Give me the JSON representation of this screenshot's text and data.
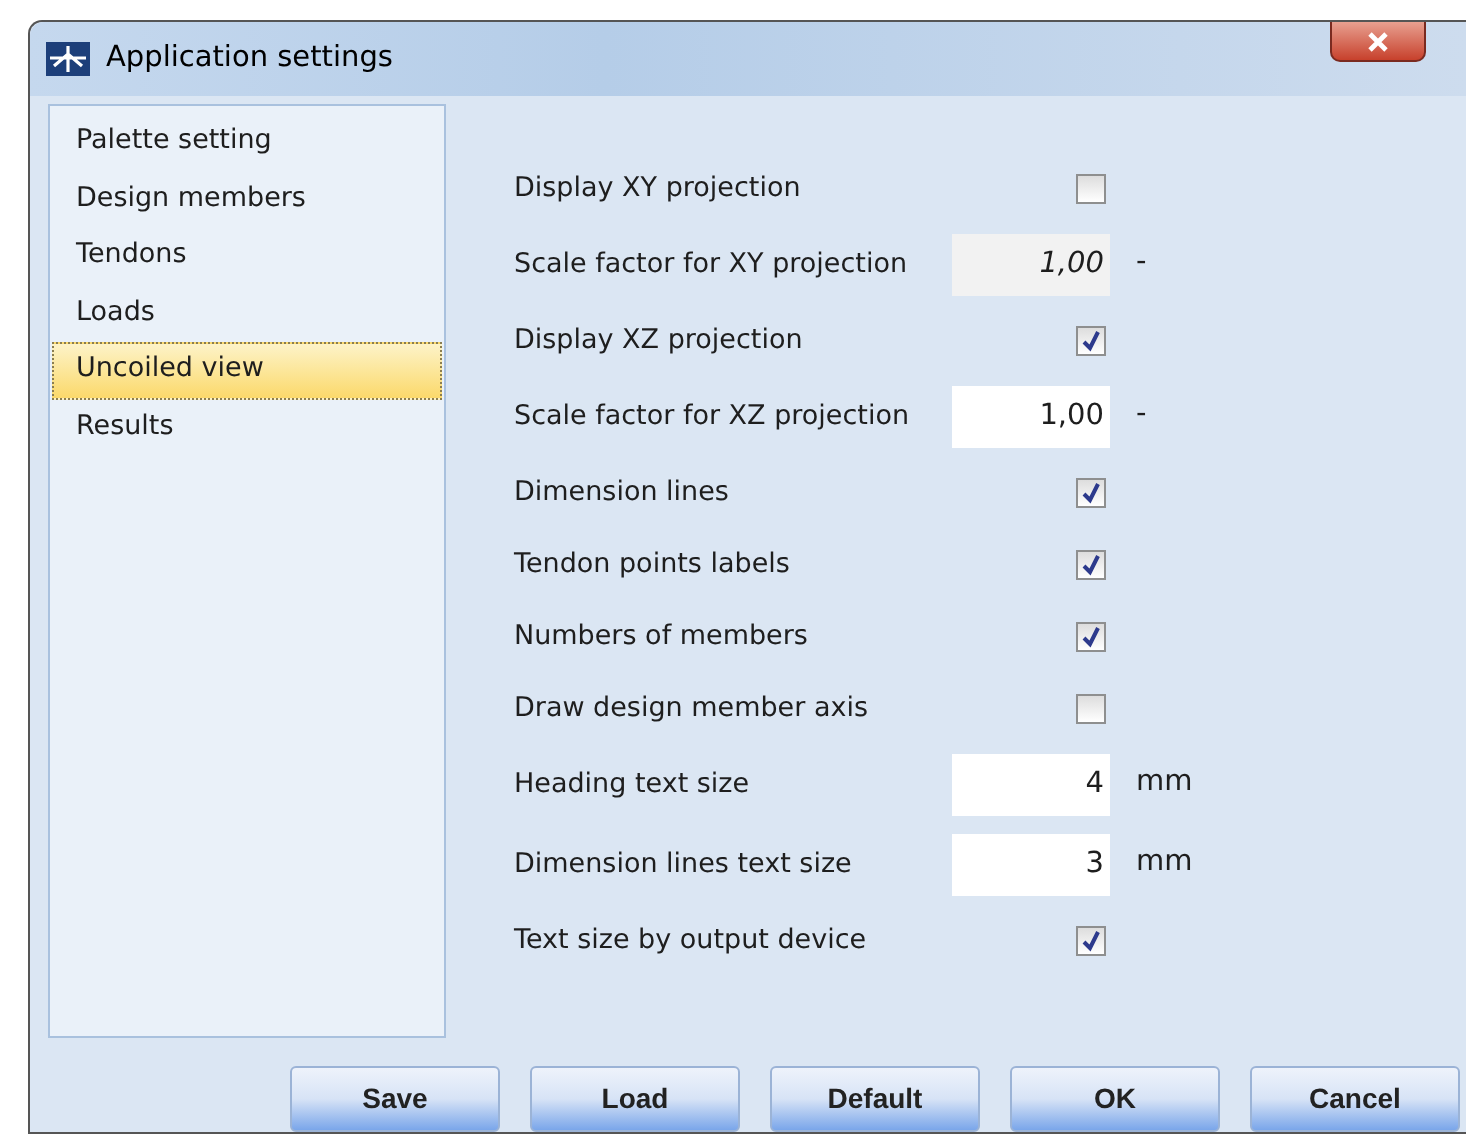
{
  "window": {
    "title": "Application settings"
  },
  "sidebar": {
    "items": [
      {
        "label": "Palette setting",
        "selected": false
      },
      {
        "label": "Design members",
        "selected": false
      },
      {
        "label": "Tendons",
        "selected": false
      },
      {
        "label": "Loads",
        "selected": false
      },
      {
        "label": "Uncoiled view",
        "selected": true
      },
      {
        "label": "Results",
        "selected": false
      }
    ]
  },
  "settings": [
    {
      "kind": "checkbox",
      "label": "Display XY projection",
      "checked": false
    },
    {
      "kind": "number",
      "label": "Scale factor for XY projection",
      "value": "1,00",
      "unit": "-",
      "disabled": true
    },
    {
      "kind": "checkbox",
      "label": "Display XZ projection",
      "checked": true
    },
    {
      "kind": "number",
      "label": "Scale factor for XZ projection",
      "value": "1,00",
      "unit": "-",
      "disabled": false
    },
    {
      "kind": "checkbox",
      "label": "Dimension lines",
      "checked": true
    },
    {
      "kind": "checkbox",
      "label": "Tendon points labels",
      "checked": true
    },
    {
      "kind": "checkbox",
      "label": "Numbers of members",
      "checked": true
    },
    {
      "kind": "checkbox",
      "label": "Draw design member axis",
      "checked": false
    },
    {
      "kind": "number",
      "label": "Heading text size",
      "value": "4",
      "unit": "mm",
      "disabled": false
    },
    {
      "kind": "number",
      "label": "Dimension lines text size",
      "value": "3",
      "unit": "mm",
      "disabled": false
    },
    {
      "kind": "checkbox",
      "label": "Text size by output device",
      "checked": true
    }
  ],
  "buttons": [
    "Save",
    "Load",
    "Default",
    "OK",
    "Cancel"
  ]
}
